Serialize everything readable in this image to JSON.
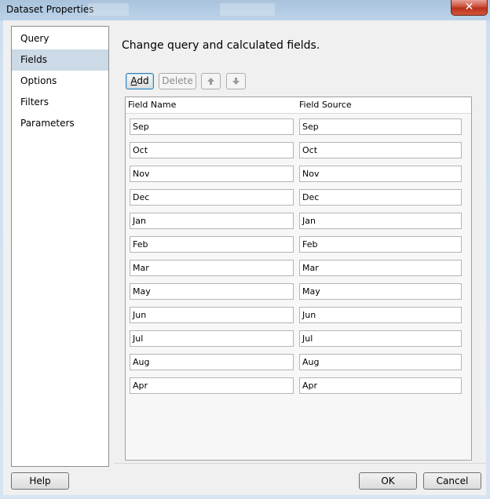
{
  "window": {
    "title": "Dataset Properties",
    "close_glyph": "✕"
  },
  "nav": {
    "items": [
      {
        "label": "Query",
        "selected": false
      },
      {
        "label": "Fields",
        "selected": true
      },
      {
        "label": "Options",
        "selected": false
      },
      {
        "label": "Filters",
        "selected": false
      },
      {
        "label": "Parameters",
        "selected": false
      }
    ]
  },
  "main": {
    "heading": "Change query and calculated fields.",
    "toolbar": {
      "add_underline": "A",
      "add_rest": "dd",
      "delete_label": "Delete",
      "move_up_icon": "arrow-up-icon",
      "move_down_icon": "arrow-down-icon"
    },
    "grid": {
      "columns": [
        "Field Name",
        "Field Source"
      ],
      "rows": [
        {
          "name": "Sep",
          "source": "Sep"
        },
        {
          "name": "Oct",
          "source": "Oct"
        },
        {
          "name": "Nov",
          "source": "Nov"
        },
        {
          "name": "Dec",
          "source": "Dec"
        },
        {
          "name": "Jan",
          "source": "Jan"
        },
        {
          "name": "Feb",
          "source": "Feb"
        },
        {
          "name": "Mar",
          "source": "Mar"
        },
        {
          "name": "May",
          "source": "May"
        },
        {
          "name": "Jun",
          "source": "Jun"
        },
        {
          "name": "Jul",
          "source": "Jul"
        },
        {
          "name": "Aug",
          "source": "Aug"
        },
        {
          "name": "Apr",
          "source": "Apr"
        }
      ]
    }
  },
  "footer": {
    "help_label": "Help",
    "ok_label": "OK",
    "cancel_label": "Cancel"
  }
}
